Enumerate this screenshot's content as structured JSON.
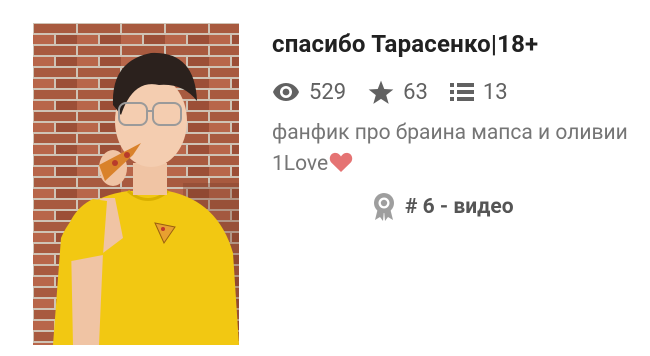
{
  "fanfic": {
    "title": "спасибо Тарасенко|18+",
    "stats": {
      "views": "529",
      "stars": "63",
      "parts": "13"
    },
    "description": "фанфик про браина мапса и оливии 1Love",
    "rank": "# 6 - видео"
  },
  "icons": {
    "views": "eye-icon",
    "stars": "star-icon",
    "parts": "list-icon",
    "rank": "award-ribbon-icon",
    "heart": "heart-icon"
  },
  "colors": {
    "text_title": "#212121",
    "text_meta": "#616161",
    "heart": "#e57373",
    "shirt": "#f2c812"
  }
}
